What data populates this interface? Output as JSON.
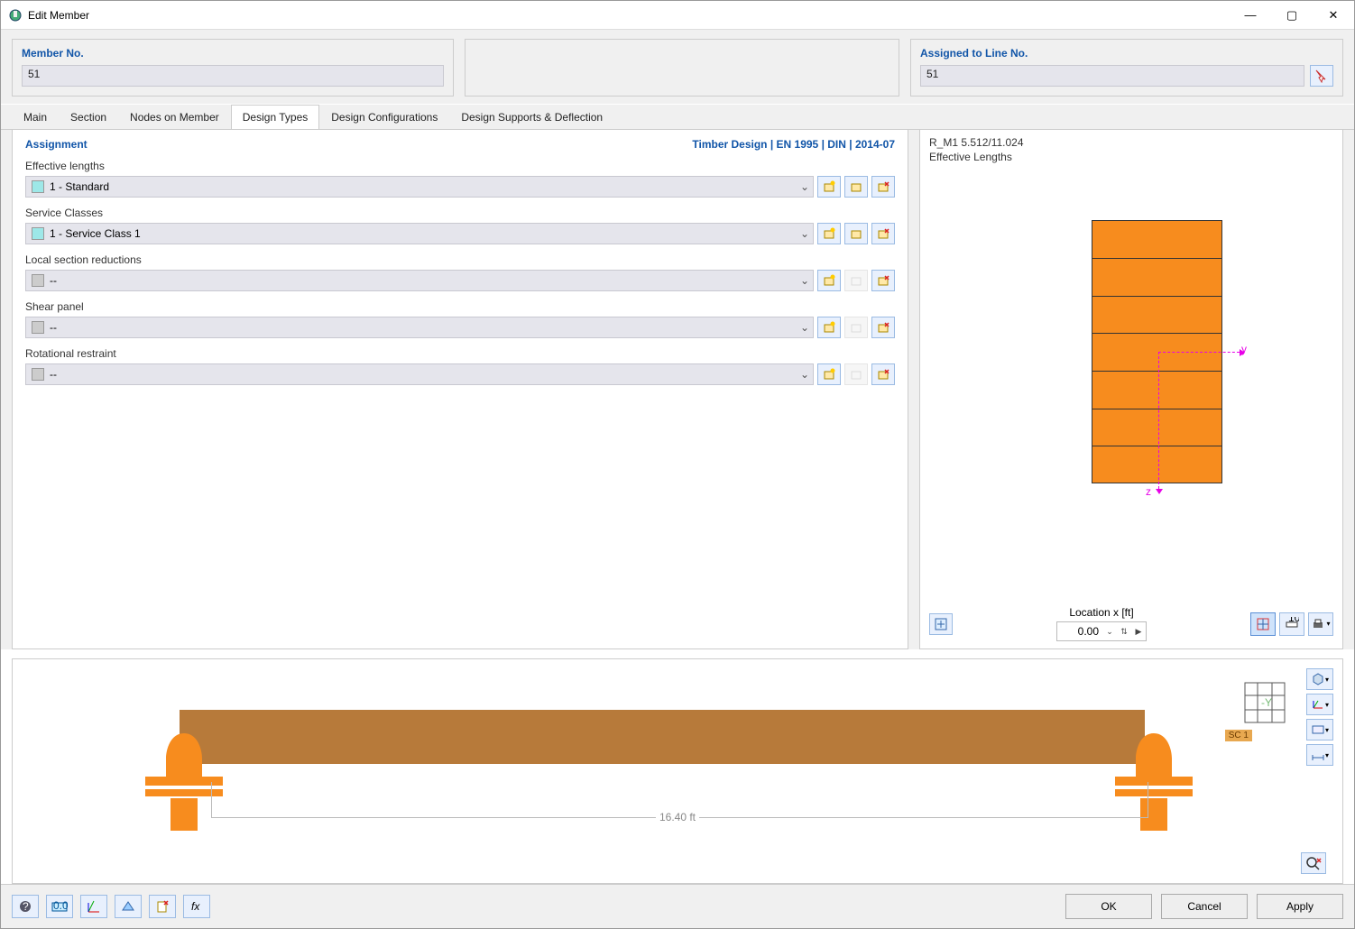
{
  "window": {
    "title": "Edit Member"
  },
  "winctl": {
    "min": "—",
    "max": "▢",
    "close": "✕"
  },
  "top": {
    "member_no_label": "Member No.",
    "member_no_value": "51",
    "assigned_label": "Assigned to Line No.",
    "assigned_value": "51"
  },
  "tabs": [
    {
      "label": "Main"
    },
    {
      "label": "Section"
    },
    {
      "label": "Nodes on Member"
    },
    {
      "label": "Design Types"
    },
    {
      "label": "Design Configurations"
    },
    {
      "label": "Design Supports & Deflection"
    }
  ],
  "active_tab_index": 3,
  "assignment": {
    "heading": "Assignment",
    "design_info": "Timber Design | EN 1995 | DIN | 2014-07",
    "fields": {
      "effective_lengths": {
        "label": "Effective lengths",
        "value": "1 - Standard",
        "swatch": "cyan"
      },
      "service_classes": {
        "label": "Service Classes",
        "value": "1 - Service Class 1",
        "swatch": "cyan"
      },
      "local_section_reductions": {
        "label": "Local section reductions",
        "value": "--",
        "swatch": "grey"
      },
      "shear_panel": {
        "label": "Shear panel",
        "value": "--",
        "swatch": "grey"
      },
      "rotational_restraint": {
        "label": "Rotational restraint",
        "value": "--",
        "swatch": "grey"
      }
    }
  },
  "right": {
    "line1": "R_M1 5.512/11.024",
    "line2": "Effective Lengths",
    "axis_y": "y",
    "axis_z": "z",
    "location_label": "Location x [ft]",
    "location_value": "0.00"
  },
  "bottom_vis": {
    "span_label": "16.40 ft",
    "sc_tag": "SC 1"
  },
  "buttons": {
    "ok": "OK",
    "cancel": "Cancel",
    "apply": "Apply"
  },
  "glyphs": {
    "chev_down": "⌄",
    "tri_right": "▶",
    "updown": "⇅"
  }
}
